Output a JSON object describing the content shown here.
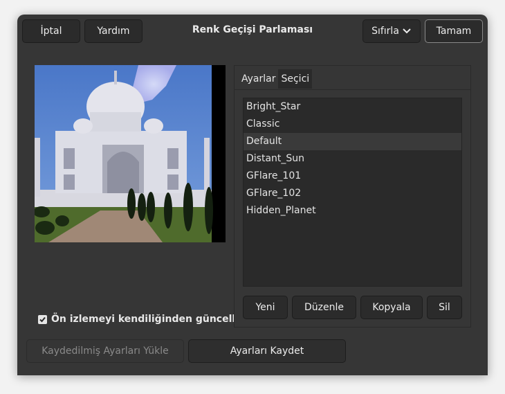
{
  "header": {
    "cancel_label": "İptal",
    "help_label": "Yardım",
    "title": "Renk Geçişi Parlaması",
    "reset_label": "Sıfırla",
    "ok_label": "Tamam"
  },
  "preview": {
    "auto_update_label": "Ön izlemeyi kendiliğinden güncelle",
    "auto_update_checked": true
  },
  "tabs": [
    {
      "label": "Ayarlar",
      "active": false
    },
    {
      "label": "Seçici",
      "active": true
    }
  ],
  "presets": {
    "items": [
      "Bright_Star",
      "Classic",
      "Default",
      "Distant_Sun",
      "GFlare_101",
      "GFlare_102",
      "Hidden_Planet"
    ],
    "selected": "Default"
  },
  "preset_buttons": {
    "new_label": "Yeni",
    "edit_label": "Düzenle",
    "copy_label": "Kopyala",
    "delete_label": "Sil"
  },
  "footer": {
    "load_label": "Kaydedilmiş Ayarları Yükle",
    "save_label": "Ayarları Kaydet"
  }
}
